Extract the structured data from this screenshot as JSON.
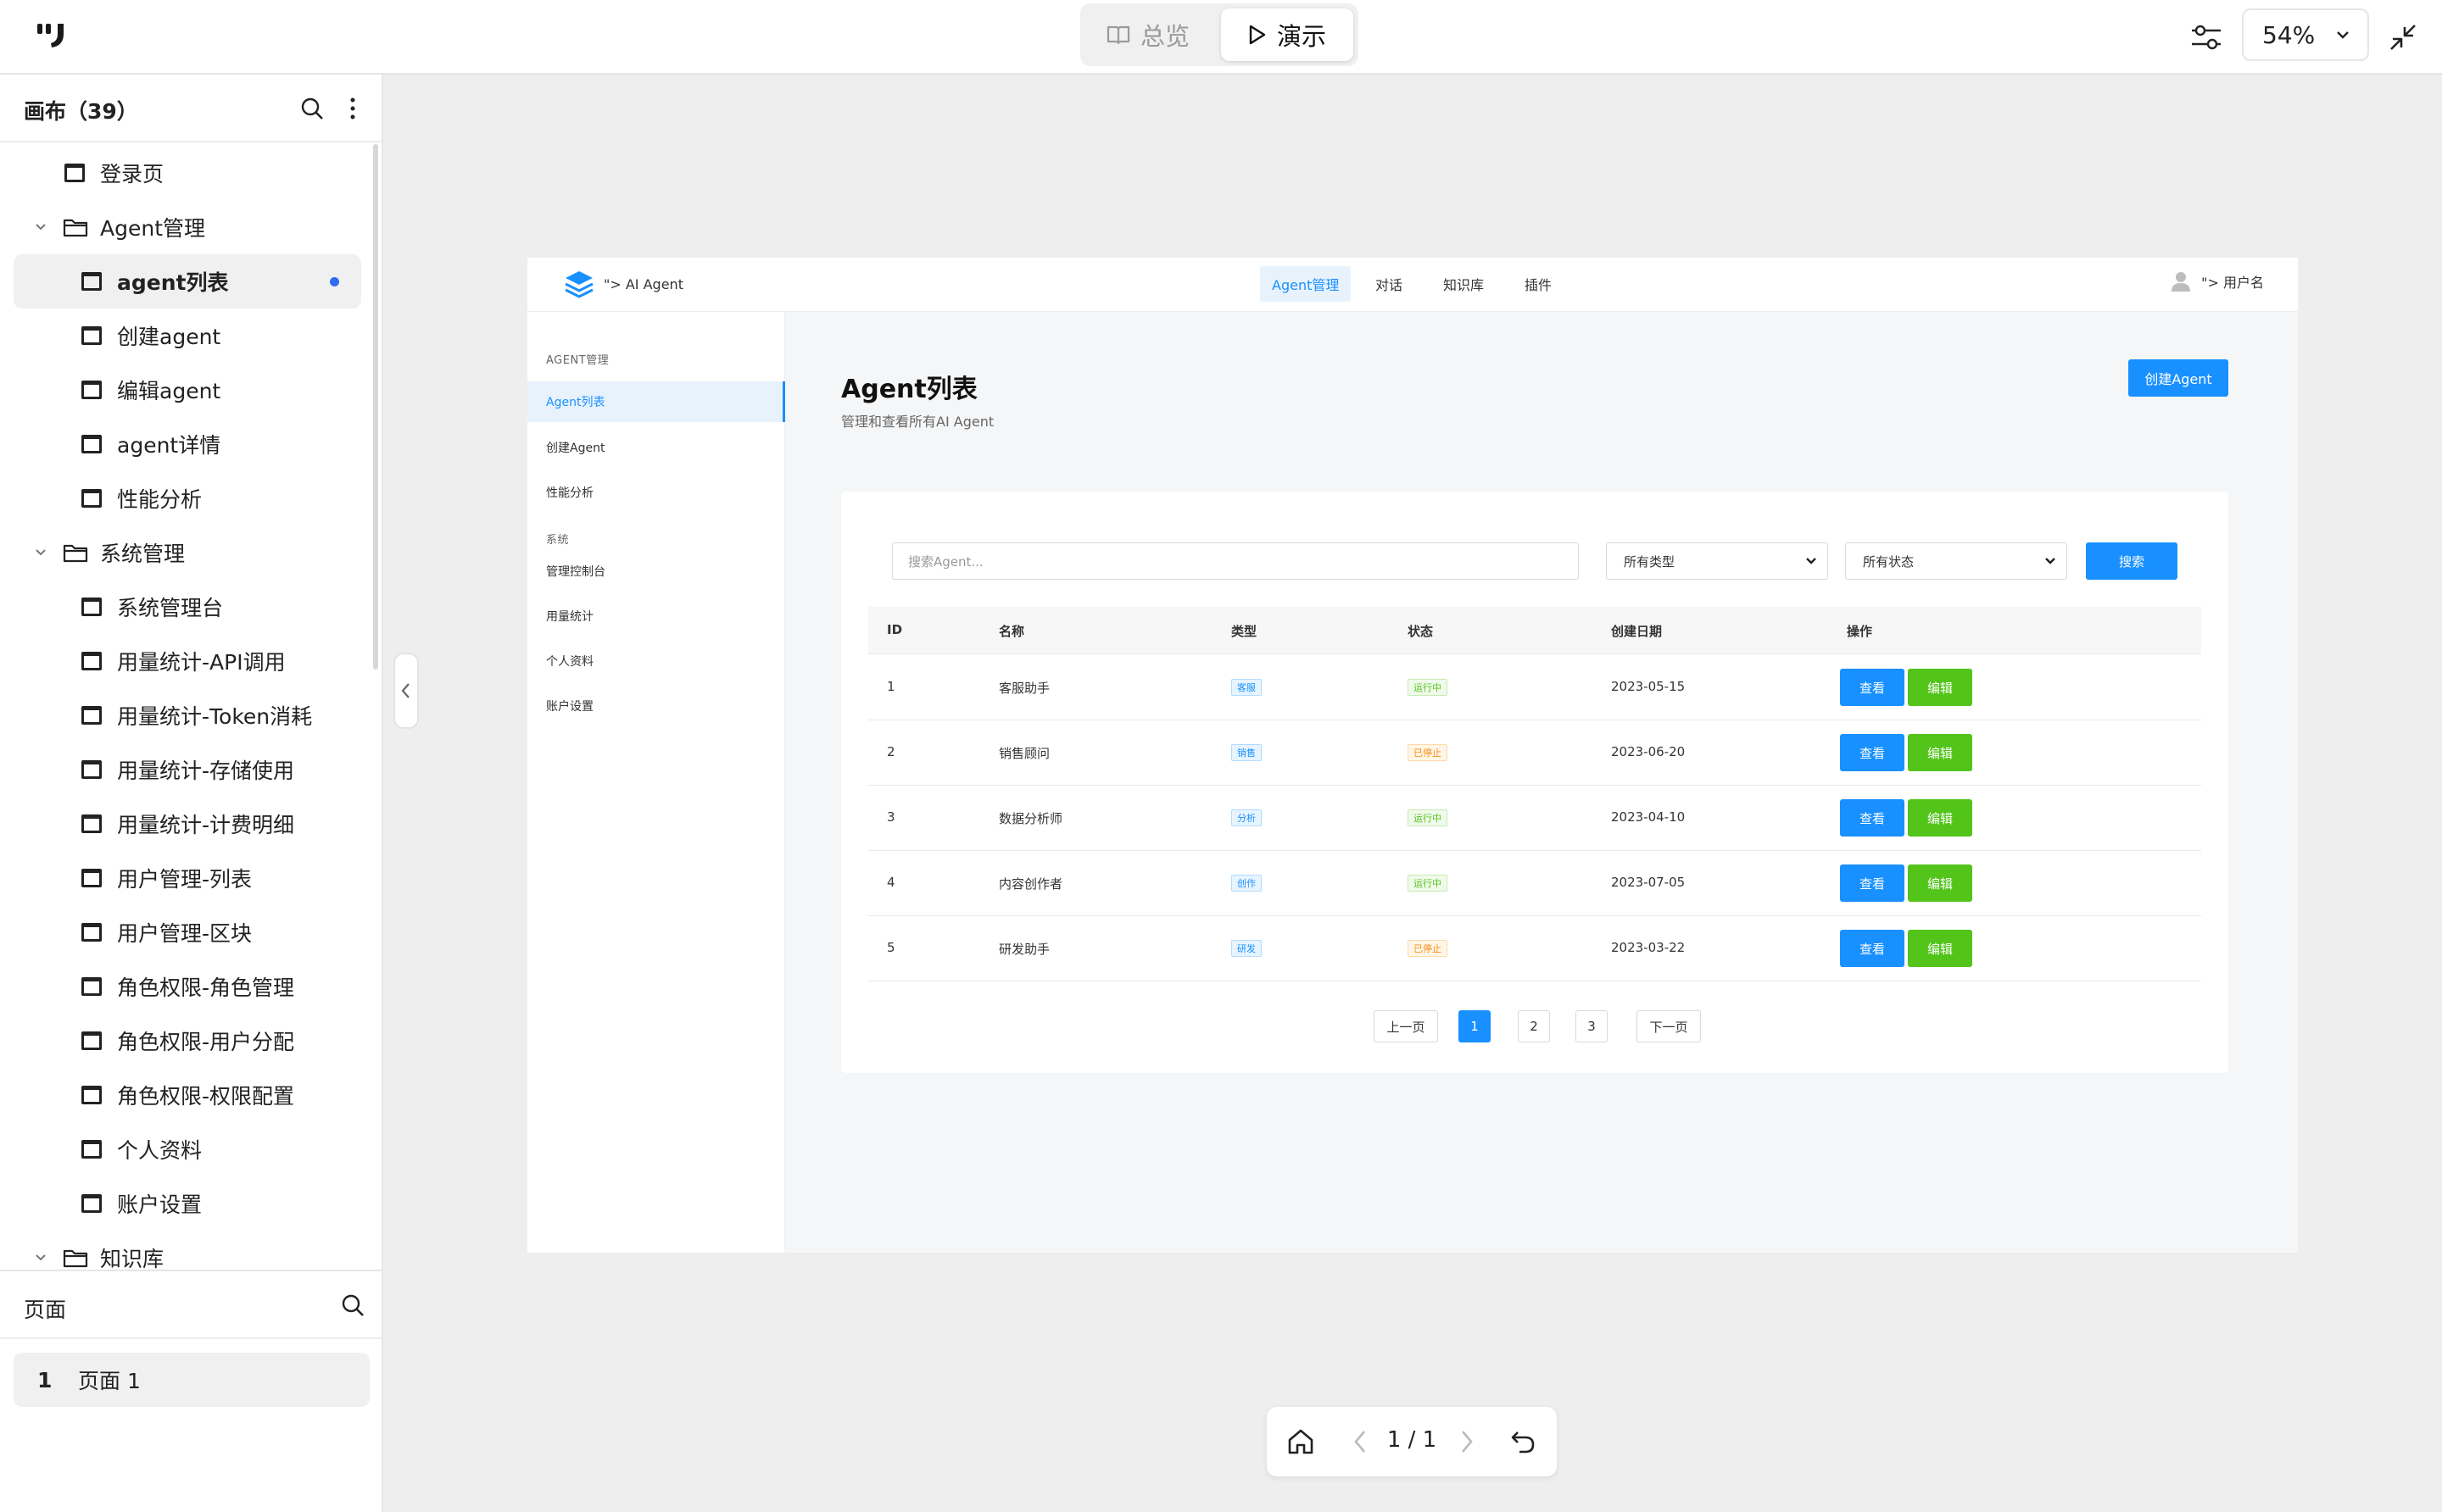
{
  "topbar": {
    "overview_label": "总览",
    "present_label": "演示",
    "zoom": "54%"
  },
  "sidebar": {
    "canvas_title": "画布（39）",
    "tree": [
      {
        "label": "登录页",
        "kind": "page",
        "level": 0
      },
      {
        "label": "Agent管理",
        "kind": "folder",
        "level": 0
      },
      {
        "label": "agent列表",
        "kind": "page",
        "level": 1,
        "selected": true
      },
      {
        "label": "创建agent",
        "kind": "page",
        "level": 1
      },
      {
        "label": "编辑agent",
        "kind": "page",
        "level": 1
      },
      {
        "label": "agent详情",
        "kind": "page",
        "level": 1
      },
      {
        "label": "性能分析",
        "kind": "page",
        "level": 1
      },
      {
        "label": "系统管理",
        "kind": "folder",
        "level": 0
      },
      {
        "label": "系统管理台",
        "kind": "page",
        "level": 1
      },
      {
        "label": "用量统计-API调用",
        "kind": "page",
        "level": 1
      },
      {
        "label": "用量统计-Token消耗",
        "kind": "page",
        "level": 1
      },
      {
        "label": "用量统计-存储使用",
        "kind": "page",
        "level": 1
      },
      {
        "label": "用量统计-计费明细",
        "kind": "page",
        "level": 1
      },
      {
        "label": "用户管理-列表",
        "kind": "page",
        "level": 1
      },
      {
        "label": "用户管理-区块",
        "kind": "page",
        "level": 1
      },
      {
        "label": "角色权限-角色管理",
        "kind": "page",
        "level": 1
      },
      {
        "label": "角色权限-用户分配",
        "kind": "page",
        "level": 1
      },
      {
        "label": "角色权限-权限配置",
        "kind": "page",
        "level": 1
      },
      {
        "label": "个人资料",
        "kind": "page",
        "level": 1
      },
      {
        "label": "账户设置",
        "kind": "page",
        "level": 1
      },
      {
        "label": "知识库",
        "kind": "folder",
        "level": 0
      }
    ],
    "pages_title": "页面",
    "pages": [
      {
        "num": "1",
        "label": "页面 1"
      }
    ]
  },
  "frame": {
    "brand": "\"> AI Agent",
    "nav": [
      "Agent管理",
      "对话",
      "知识库",
      "插件"
    ],
    "user": "\"> 用户名",
    "side_sections": [
      {
        "title": "AGENT管理",
        "items": [
          "Agent列表",
          "创建Agent",
          "性能分析"
        ]
      },
      {
        "title": "系统",
        "items": [
          "管理控制台",
          "用量统计",
          "个人资料",
          "账户设置"
        ]
      }
    ],
    "title": "Agent列表",
    "subtitle": "管理和查看所有AI Agent",
    "create_btn": "创建Agent",
    "search_placeholder": "搜索Agent...",
    "type_select": "所有类型",
    "status_select": "所有状态",
    "search_btn": "搜索",
    "columns": [
      "ID",
      "名称",
      "类型",
      "状态",
      "创建日期",
      "操作"
    ],
    "rows": [
      {
        "id": "1",
        "name": "客服助手",
        "type": "客服",
        "status": "运行中",
        "status_kind": "run",
        "date": "2023-05-15"
      },
      {
        "id": "2",
        "name": "销售顾问",
        "type": "销售",
        "status": "已停止",
        "status_kind": "stop",
        "date": "2023-06-20"
      },
      {
        "id": "3",
        "name": "数据分析师",
        "type": "分析",
        "status": "运行中",
        "status_kind": "run",
        "date": "2023-04-10"
      },
      {
        "id": "4",
        "name": "内容创作者",
        "type": "创作",
        "status": "运行中",
        "status_kind": "run",
        "date": "2023-07-05"
      },
      {
        "id": "5",
        "name": "研发助手",
        "type": "研发",
        "status": "已停止",
        "status_kind": "stop",
        "date": "2023-03-22"
      }
    ],
    "view_label": "查看",
    "edit_label": "编辑",
    "pagination": {
      "prev": "上一页",
      "pages": [
        "1",
        "2",
        "3"
      ],
      "current": "1",
      "next": "下一页"
    }
  },
  "bottom": {
    "page_count": "1 / 1"
  },
  "colors": {
    "primary": "#1890ff",
    "success": "#52c41a",
    "warning": "#fa8c16",
    "selection_dot": "#2f6bf1"
  }
}
